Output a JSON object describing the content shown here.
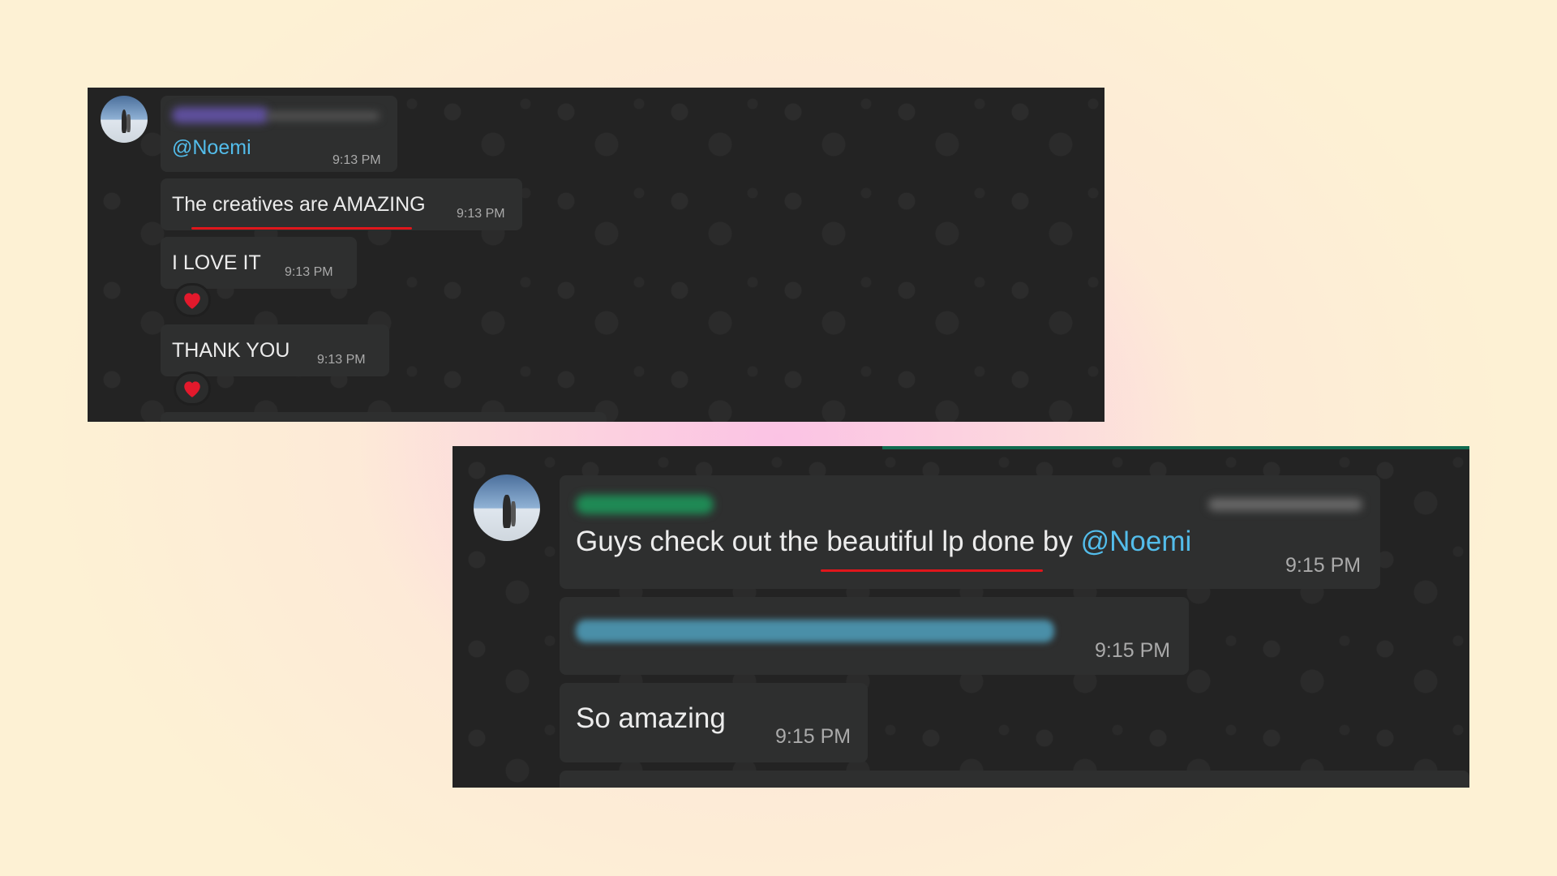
{
  "screenshot_1": {
    "avatar_icon": "profile-photo",
    "messages": [
      {
        "text": "@Noemi",
        "time": "9:13 PM",
        "has_redacted_sender": true
      },
      {
        "text": "The creatives are AMAZING",
        "time": "9:13 PM"
      },
      {
        "text": "I LOVE IT",
        "time": "9:13 PM",
        "reaction": "red-heart-icon"
      },
      {
        "text": "THANK YOU",
        "time": "9:13 PM",
        "reaction": "red-heart-icon"
      }
    ]
  },
  "screenshot_2": {
    "avatar_icon": "profile-photo",
    "messages": [
      {
        "text_before": "Guys check out the beautiful lp done by ",
        "mention": "@Noemi",
        "time": "9:15 PM",
        "has_redacted_sender": true
      },
      {
        "link_redacted": true,
        "time": "9:15 PM"
      },
      {
        "text": "So amazing",
        "time": "9:15 PM"
      }
    ]
  },
  "colors": {
    "chat_background": "#232323",
    "bubble": "#2e2f2f",
    "mention": "#53bdeb",
    "timestamp": "#aaaaaa",
    "highlight_underline": "#e0161b",
    "page_background": "#fdf1d4"
  }
}
